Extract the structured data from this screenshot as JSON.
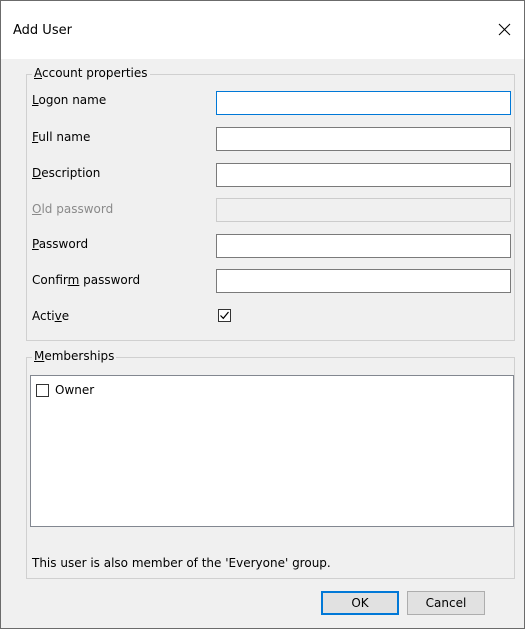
{
  "window": {
    "title": "Add User",
    "close_icon": "close-icon"
  },
  "account_properties": {
    "legend_prefix": "",
    "legend_u": "A",
    "legend_rest": "ccount properties",
    "fields": {
      "logon_name": {
        "label_pre": "",
        "label_u": "L",
        "label_post": "ogon name",
        "value": ""
      },
      "full_name": {
        "label_pre": "",
        "label_u": "F",
        "label_post": "ull name",
        "value": ""
      },
      "description": {
        "label_pre": "",
        "label_u": "D",
        "label_post": "escription",
        "value": ""
      },
      "old_password": {
        "label_pre": "",
        "label_u": "O",
        "label_post": "ld password",
        "value": ""
      },
      "password": {
        "label_pre": "",
        "label_u": "P",
        "label_post": "assword",
        "value": ""
      },
      "confirm_password": {
        "label_pre": "Confir",
        "label_u": "m",
        "label_post": " password",
        "value": ""
      }
    },
    "active": {
      "label_pre": "Acti",
      "label_u": "v",
      "label_post": "e",
      "checked": true
    }
  },
  "memberships": {
    "legend_u": "M",
    "legend_rest": "emberships",
    "items": [
      {
        "label": "Owner",
        "checked": false
      }
    ]
  },
  "info_text": "This user is also member of the 'Everyone' group.",
  "buttons": {
    "ok": "OK",
    "cancel": "Cancel"
  },
  "colors": {
    "accent": "#0078d7",
    "dialog_bg": "#f0f0f0",
    "titlebar_bg": "#ffffff"
  }
}
